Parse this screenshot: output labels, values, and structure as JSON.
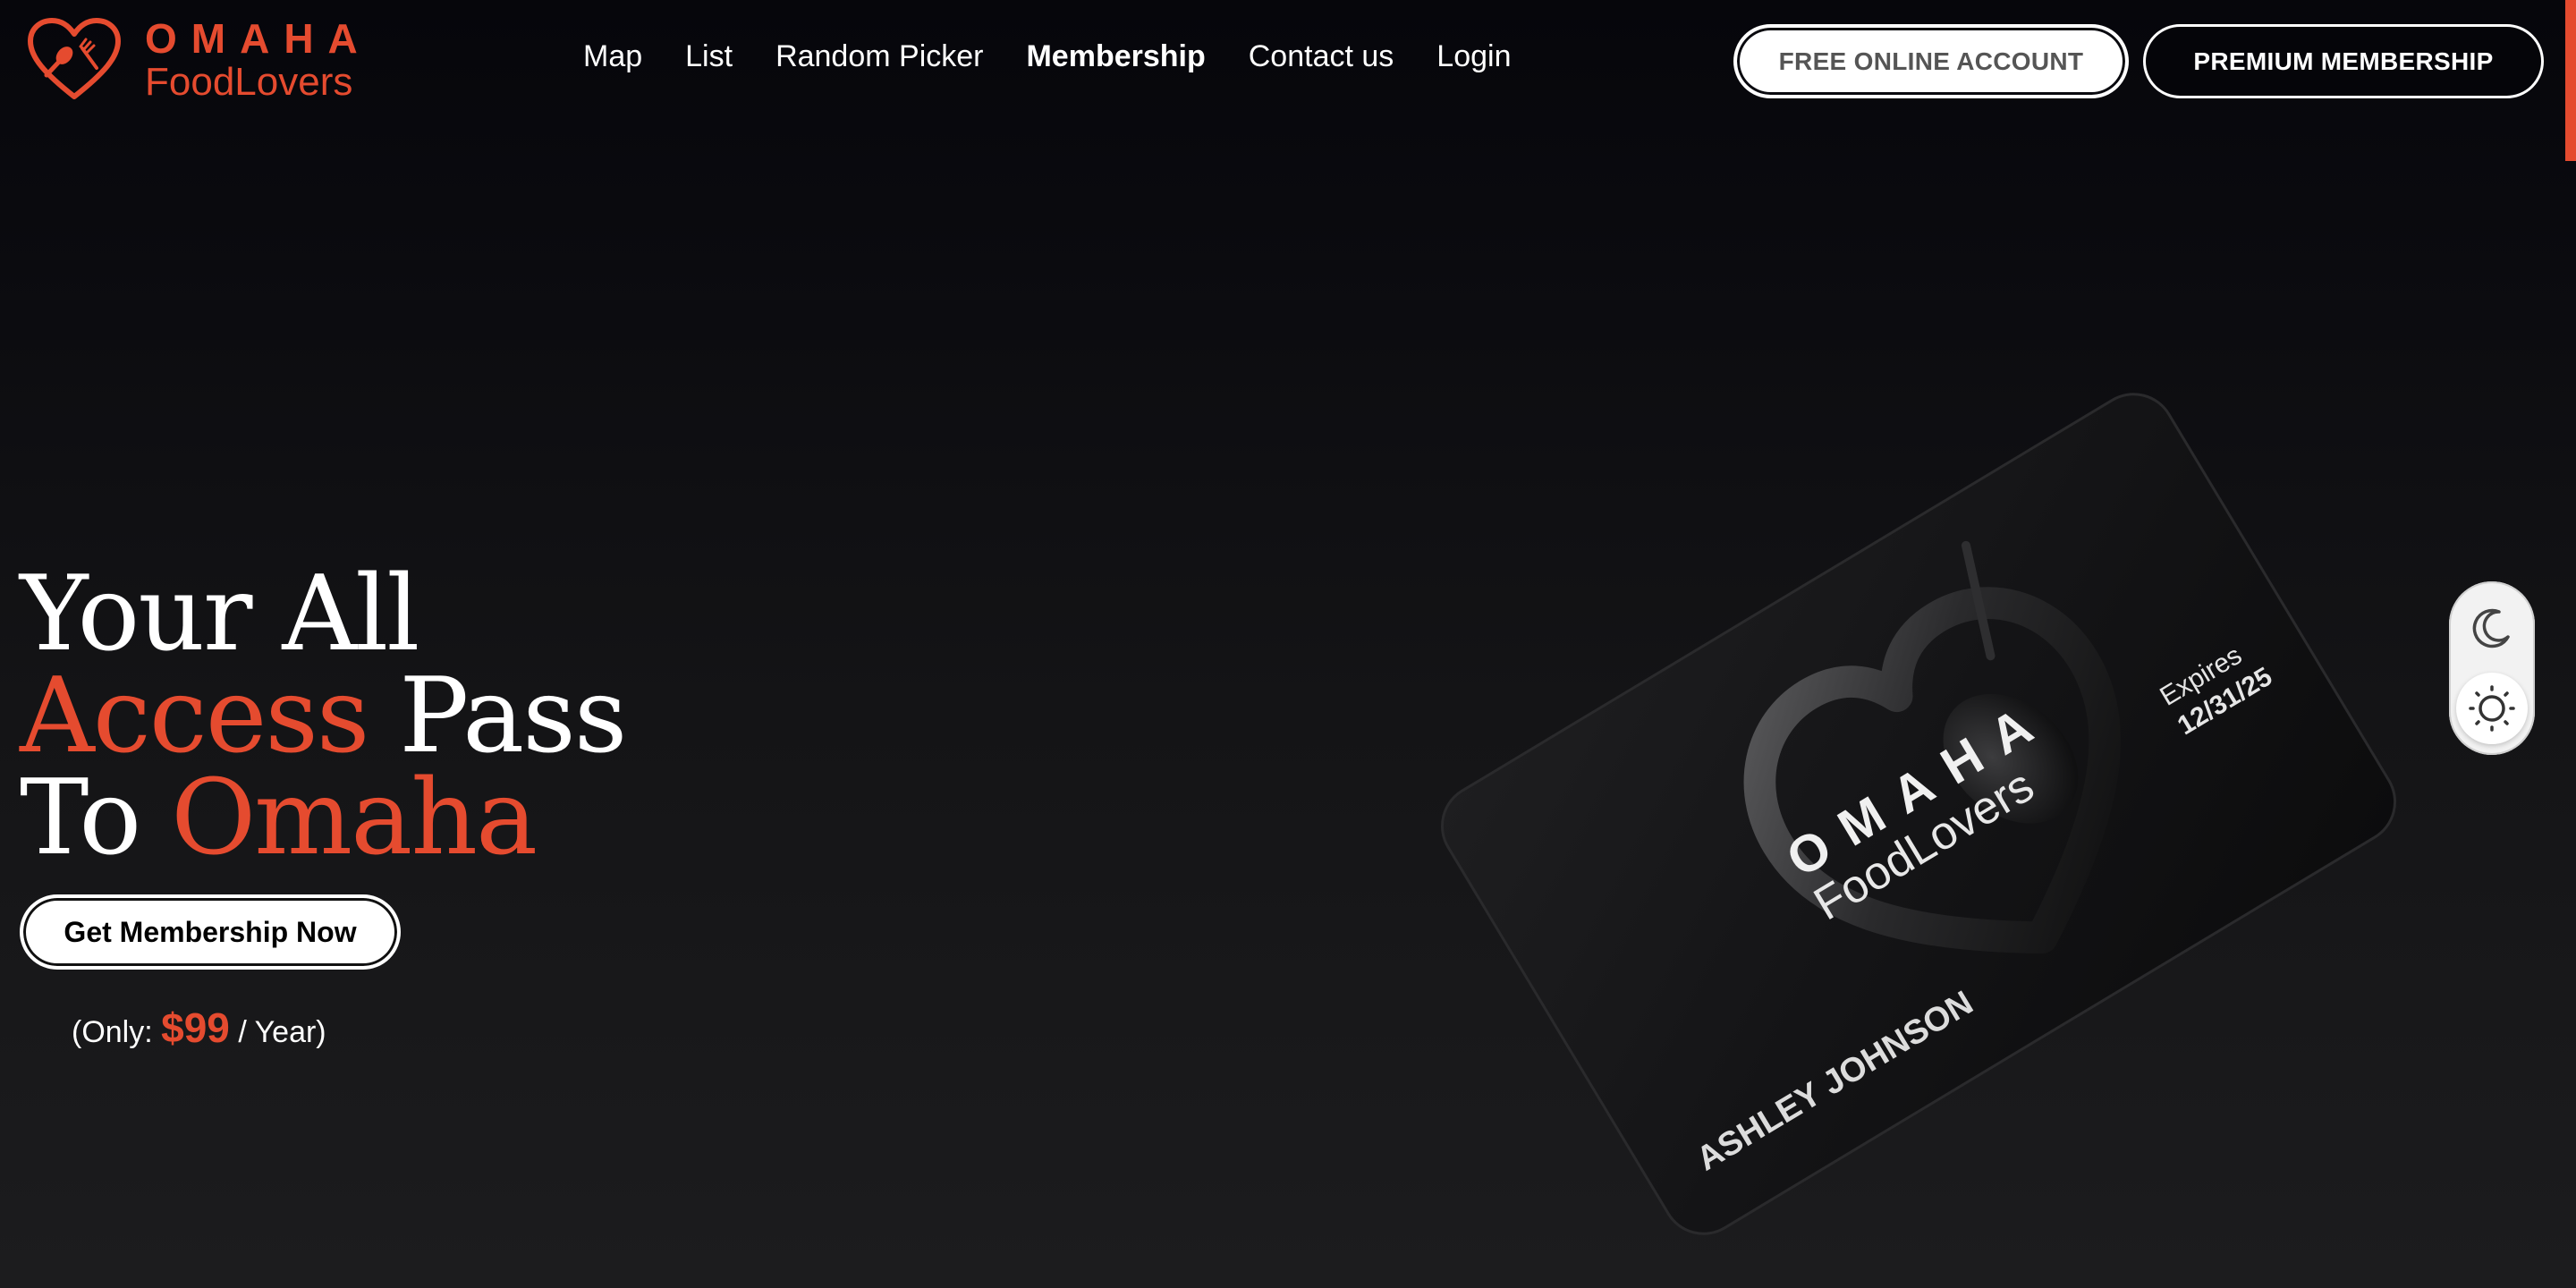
{
  "brand": {
    "line1": "OMAHA",
    "line2": "FoodLovers",
    "color": "#e54b2f"
  },
  "nav": {
    "items": [
      {
        "label": "Map",
        "active": false
      },
      {
        "label": "List",
        "active": false
      },
      {
        "label": "Random Picker",
        "active": false
      },
      {
        "label": "Membership",
        "active": true
      },
      {
        "label": "Contact us",
        "active": false
      },
      {
        "label": "Login",
        "active": false
      }
    ]
  },
  "header_buttons": {
    "free_label": "FREE ONLINE ACCOUNT",
    "premium_label": "PREMIUM MEMBERSHIP"
  },
  "hero": {
    "title_line1": "Your All",
    "title_line2_accent": "Access",
    "title_line2_rest": " Pass",
    "title_line3_start": "To ",
    "title_line3_accent": "Omaha",
    "cta_label": "Get Membership Now",
    "price_prefix": "(Only: ",
    "price_amount": "$99",
    "price_suffix": " / Year)"
  },
  "card": {
    "brand_line1": "OMAHA",
    "brand_line2": "FoodLovers",
    "expires_label": "Expires",
    "expires_date": "12/31/25",
    "holder_name": "ASHLEY JOHNSON"
  },
  "theme_toggle": {
    "icons": [
      "moon-icon",
      "sun-icon"
    ],
    "selected": "sun"
  },
  "colors": {
    "accent": "#e54b2f",
    "background": "#0c0c10",
    "text": "#ffffff"
  }
}
